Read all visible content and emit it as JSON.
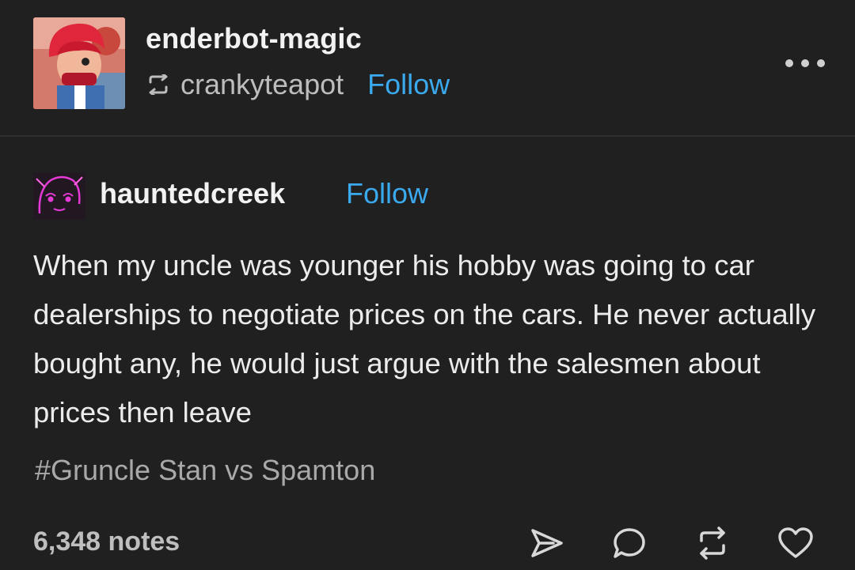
{
  "header": {
    "blog_name": "enderbot-magic",
    "reblogged_from": "crankyteapot",
    "follow_label": "Follow",
    "avatar_icon": "avatar-red-haired-character",
    "more_icon": "more-options-icon"
  },
  "entry": {
    "author": "hauntedcreek",
    "follow_label": "Follow",
    "avatar_icon": "avatar-pink-sketch",
    "text": "When my uncle was younger his hobby was going to car dealerships to negotiate prices on the cars. He never actually bought any, he would just argue with the salesmen about prices then leave",
    "tag": "#Gruncle Stan vs Spamton"
  },
  "footer": {
    "notes": "6,348 notes",
    "actions": [
      "share-icon",
      "reply-icon",
      "reblog-icon",
      "like-icon"
    ]
  },
  "colors": {
    "background": "#202020",
    "link": "#3aa9ee",
    "text": "#ececec",
    "muted": "#a9a9a9"
  }
}
